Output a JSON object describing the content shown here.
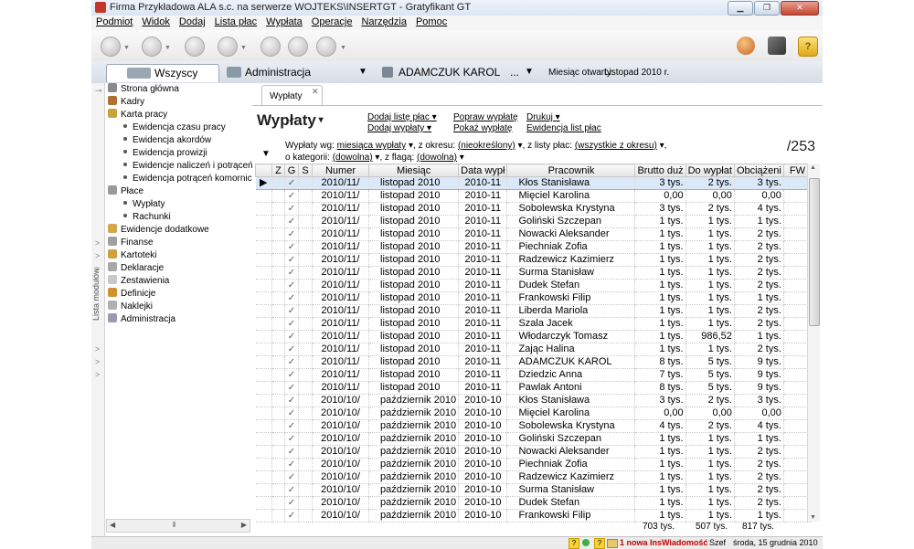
{
  "window": {
    "title": "Firma Przykładowa ALA s.c. na serwerze WOJTEKS\\INSERTGT - Gratyfikant GT",
    "min": "▁",
    "max": "❐",
    "close": "✕"
  },
  "menu": [
    "Podmiot",
    "Widok",
    "Dodaj",
    "Lista płac",
    "Wypłata",
    "Operacje",
    "Narzędzia",
    "Pomoc"
  ],
  "context": {
    "group": "Wszyscy",
    "department": "Administracja",
    "employee": "ADAMCZUK KAROL",
    "employee_more": "...",
    "month_label": "Miesiąc otwarty:",
    "month_value": "Listopad 2010 r."
  },
  "sidebar": {
    "strip_label": "Lista modułów",
    "items": [
      {
        "label": "Strona główna",
        "color": "#8a8a8a"
      },
      {
        "label": "Kadry",
        "color": "#b07030"
      },
      {
        "label": "Karta pracy",
        "color": "#c9a23a"
      },
      {
        "label": "Płace",
        "color": "#9a9a9a"
      },
      {
        "label": "Ewidencje dodatkowe",
        "color": "#d4a64a"
      },
      {
        "label": "Finanse",
        "color": "#a0a0a0"
      },
      {
        "label": "Kartoteki",
        "color": "#d0a040"
      },
      {
        "label": "Deklaracje",
        "color": "#a8a8a8"
      },
      {
        "label": "Zestawienia",
        "color": "#c8c8c8"
      },
      {
        "label": "Definicje",
        "color": "#d09030"
      },
      {
        "label": "Naklejki",
        "color": "#b0b0b0"
      },
      {
        "label": "Administracja",
        "color": "#9a9ab0"
      }
    ],
    "karta_sub": [
      "Ewidencja czasu pracy",
      "Ewidencja akordów",
      "Ewidencja prowizji",
      "Ewidencje naliczeń i potrąceń",
      "Ewidencja potrąceń komornic"
    ],
    "place_sub": [
      "Wypłaty",
      "Rachunki"
    ]
  },
  "doc_tab": {
    "label": "Wypłaty",
    "close": "✕"
  },
  "page": {
    "title": "Wypłaty",
    "actions": {
      "add_list": "Dodaj listę płac",
      "add_payout": "Dodaj wypłaty",
      "fix_payout": "Popraw wypłatę",
      "show_payout": "Pokaż wypłatę",
      "print": "Drukuj",
      "list_register": "Ewidencja list płac"
    },
    "filters": {
      "row1": {
        "t1": "Wypłaty wg:",
        "v1": "miesiąca wypłaty",
        "t2": ", z okresu:",
        "v2": "(nieokreślony)",
        "t3": ", z listy płac:",
        "v3": "(wszystkie z okresu)",
        "t4": ","
      },
      "row2": {
        "t1": "o kategorii:",
        "v1": "(dowolna)",
        "t2": ", z flagą:",
        "v2": "(dowolna)"
      }
    },
    "count": "/253"
  },
  "table": {
    "headers": [
      "",
      "Z",
      "G",
      "S",
      "Numer",
      "Miesiąc",
      "Data wypł",
      "Pracownik",
      "Brutto duż",
      "Do wypłat",
      "Obciążeni",
      "FW"
    ],
    "check": "✓",
    "rows": [
      [
        "2010/11/",
        "listopad 2010",
        "2010-11",
        "Kłos Stanisława",
        "3 tys.",
        "2 tys.",
        "3 tys."
      ],
      [
        "2010/11/",
        "listopad 2010",
        "2010-11",
        "Mięciel Karolina",
        "0,00",
        "0,00",
        "0,00"
      ],
      [
        "2010/11/",
        "listopad 2010",
        "2010-11",
        "Sobolewska Krystyna",
        "3 tys.",
        "2 tys.",
        "4 tys."
      ],
      [
        "2010/11/",
        "listopad 2010",
        "2010-11",
        "Goliński Szczepan",
        "1 tys.",
        "1 tys.",
        "1 tys."
      ],
      [
        "2010/11/",
        "listopad 2010",
        "2010-11",
        "Nowacki Aleksander",
        "1 tys.",
        "1 tys.",
        "2 tys."
      ],
      [
        "2010/11/",
        "listopad 2010",
        "2010-11",
        "Piechniak Zofia",
        "1 tys.",
        "1 tys.",
        "2 tys."
      ],
      [
        "2010/11/",
        "listopad 2010",
        "2010-11",
        "Radzewicz Kazimierz",
        "1 tys.",
        "1 tys.",
        "2 tys."
      ],
      [
        "2010/11/",
        "listopad 2010",
        "2010-11",
        "Surma Stanisław",
        "1 tys.",
        "1 tys.",
        "2 tys."
      ],
      [
        "2010/11/",
        "listopad 2010",
        "2010-11",
        "Dudek Stefan",
        "1 tys.",
        "1 tys.",
        "2 tys."
      ],
      [
        "2010/11/",
        "listopad 2010",
        "2010-11",
        "Frankowski Filip",
        "1 tys.",
        "1 tys.",
        "1 tys."
      ],
      [
        "2010/11/",
        "listopad 2010",
        "2010-11",
        "Liberda Mariola",
        "1 tys.",
        "1 tys.",
        "2 tys."
      ],
      [
        "2010/11/",
        "listopad 2010",
        "2010-11",
        "Szala Jacek",
        "1 tys.",
        "1 tys.",
        "2 tys."
      ],
      [
        "2010/11/",
        "listopad 2010",
        "2010-11",
        "Włodarczyk Tomasz",
        "1 tys.",
        "986,52",
        "1 tys."
      ],
      [
        "2010/11/",
        "listopad 2010",
        "2010-11",
        "Zając Halina",
        "1 tys.",
        "1 tys.",
        "2 tys."
      ],
      [
        "2010/11/",
        "listopad 2010",
        "2010-11",
        "ADAMCZUK KAROL",
        "8 tys.",
        "5 tys.",
        "9 tys."
      ],
      [
        "2010/11/",
        "listopad 2010",
        "2010-11",
        "Dziedzic Anna",
        "7 tys.",
        "5 tys.",
        "9 tys."
      ],
      [
        "2010/11/",
        "listopad 2010",
        "2010-11",
        "Pawlak Antoni",
        "8 tys.",
        "5 tys.",
        "9 tys."
      ],
      [
        "2010/10/",
        "październik 2010",
        "2010-10",
        "Kłos Stanisława",
        "3 tys.",
        "2 tys.",
        "3 tys."
      ],
      [
        "2010/10/",
        "październik 2010",
        "2010-10",
        "Mięciel Karolina",
        "0,00",
        "0,00",
        "0,00"
      ],
      [
        "2010/10/",
        "październik 2010",
        "2010-10",
        "Sobolewska Krystyna",
        "4 tys.",
        "2 tys.",
        "4 tys."
      ],
      [
        "2010/10/",
        "październik 2010",
        "2010-10",
        "Goliński Szczepan",
        "1 tys.",
        "1 tys.",
        "1 tys."
      ],
      [
        "2010/10/",
        "październik 2010",
        "2010-10",
        "Nowacki Aleksander",
        "1 tys.",
        "1 tys.",
        "2 tys."
      ],
      [
        "2010/10/",
        "październik 2010",
        "2010-10",
        "Piechniak Zofia",
        "1 tys.",
        "1 tys.",
        "2 tys."
      ],
      [
        "2010/10/",
        "październik 2010",
        "2010-10",
        "Radzewicz Kazimierz",
        "1 tys.",
        "1 tys.",
        "2 tys."
      ],
      [
        "2010/10/",
        "październik 2010",
        "2010-10",
        "Surma Stanisław",
        "1 tys.",
        "1 tys.",
        "2 tys."
      ],
      [
        "2010/10/",
        "październik 2010",
        "2010-10",
        "Dudek Stefan",
        "1 tys.",
        "1 tys.",
        "2 tys."
      ],
      [
        "2010/10/",
        "październik 2010",
        "2010-10",
        "Frankowski Filip",
        "1 tys.",
        "1 tys.",
        "1 tys."
      ]
    ],
    "totals": {
      "brutto": "703 tys.",
      "do_wyplaty": "507 tys.",
      "obciazenia": "817 tys."
    }
  },
  "status": {
    "message": "1 nowa InsWiadomość",
    "user": "Szef",
    "date": "środa, 15 grudnia 2010"
  }
}
